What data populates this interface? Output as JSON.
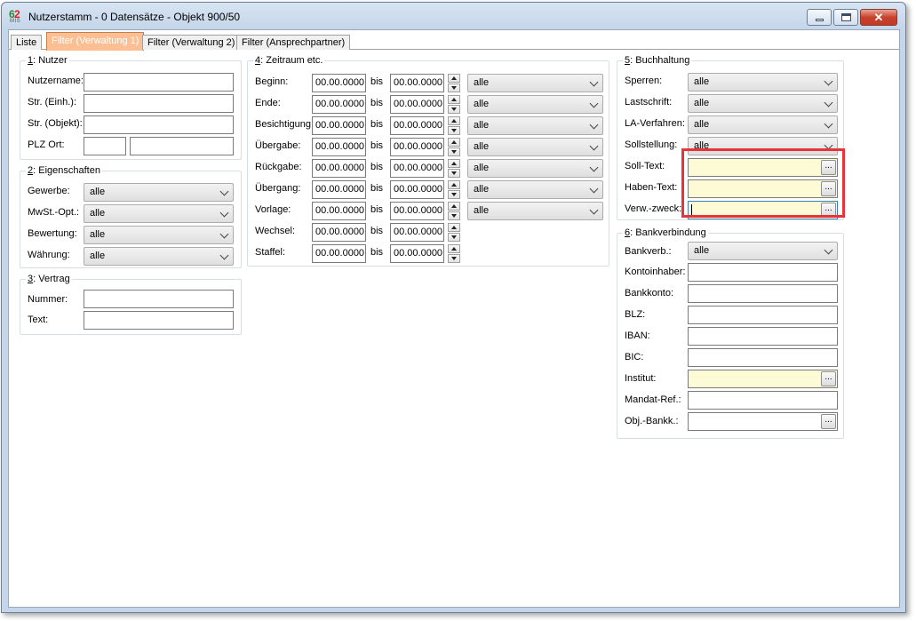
{
  "window": {
    "title": "Nutzerstamm - 0 Datensätze - Objekt 900/50",
    "icon_number": "6",
    "icon_number2": "2",
    "icon_sub": "MIS",
    "close_glyph": "✕"
  },
  "tabs": [
    "Liste",
    "Filter (Verwaltung 1)",
    "Filter (Verwaltung 2)",
    "Filter (Ansprechpartner)"
  ],
  "active_tab": "Filter (Verwaltung 1)",
  "nutzer": {
    "num": "1",
    "title": ": Nutzer",
    "labels": [
      "Nutzername:",
      "Str. (Einh.):",
      "Str. (Objekt):",
      "PLZ Ort:"
    ],
    "values": [
      "",
      "",
      "",
      "",
      ""
    ]
  },
  "eigenschaften": {
    "num": "2",
    "title": ": Eigenschaften",
    "rows": [
      {
        "label": "Gewerbe:",
        "value": "alle"
      },
      {
        "label": "MwSt.-Opt.:",
        "value": "alle"
      },
      {
        "label": "Bewertung:",
        "value": "alle"
      },
      {
        "label": "Währung:",
        "value": "alle"
      }
    ]
  },
  "vertrag": {
    "num": "3",
    "title": ": Vertrag",
    "labels": [
      "Nummer:",
      "Text:"
    ],
    "values": [
      "",
      ""
    ]
  },
  "zeitraum": {
    "num": "4",
    "title": ": Zeitraum etc.",
    "bis": "bis",
    "rows": [
      {
        "label": "Beginn:",
        "from": "00.00.0000",
        "to": "00.00.0000",
        "select": "alle"
      },
      {
        "label": "Ende:",
        "from": "00.00.0000",
        "to": "00.00.0000",
        "select": "alle"
      },
      {
        "label": "Besichtigung:",
        "from": "00.00.0000",
        "to": "00.00.0000",
        "select": "alle"
      },
      {
        "label": "Übergabe:",
        "from": "00.00.0000",
        "to": "00.00.0000",
        "select": "alle"
      },
      {
        "label": "Rückgabe:",
        "from": "00.00.0000",
        "to": "00.00.0000",
        "select": "alle"
      },
      {
        "label": "Übergang:",
        "from": "00.00.0000",
        "to": "00.00.0000",
        "select": "alle"
      },
      {
        "label": "Vorlage:",
        "from": "00.00.0000",
        "to": "00.00.0000",
        "select": "alle"
      },
      {
        "label": "Wechsel:",
        "from": "00.00.0000",
        "to": "00.00.0000"
      },
      {
        "label": "Staffel:",
        "from": "00.00.0000",
        "to": "00.00.0000"
      }
    ]
  },
  "buchhaltung": {
    "num": "5",
    "title": ": Buchhaltung",
    "selects": [
      {
        "label": "Sperren:",
        "value": "alle"
      },
      {
        "label": "Lastschrift:",
        "value": "alle"
      },
      {
        "label": "LA-Verfahren:",
        "value": "alle"
      },
      {
        "label": "Sollstellung:",
        "value": "alle"
      }
    ],
    "texts": [
      {
        "label": "Soll-Text:",
        "value": ""
      },
      {
        "label": "Haben-Text:",
        "value": ""
      },
      {
        "label": "Verw.-zweck:",
        "value": ""
      }
    ],
    "dots": "..."
  },
  "bank": {
    "num": "6",
    "title": ": Bankverbindung",
    "select": {
      "label": "Bankverb.:",
      "value": "alle"
    },
    "fields": [
      {
        "label": "Kontoinhaber:",
        "value": ""
      },
      {
        "label": "Bankkonto:",
        "value": ""
      },
      {
        "label": "BLZ:",
        "value": ""
      },
      {
        "label": "IBAN:",
        "value": ""
      },
      {
        "label": "BIC:",
        "value": ""
      },
      {
        "label": "Institut:",
        "value": ""
      },
      {
        "label": "Mandat-Ref.:",
        "value": ""
      },
      {
        "label": "Obj.-Bankk.:",
        "value": ""
      }
    ],
    "dots": "..."
  },
  "colors": {
    "active_tab": "#fbbf93",
    "lookup_field": "#fdfbd6",
    "highlight": "#e8333a"
  }
}
